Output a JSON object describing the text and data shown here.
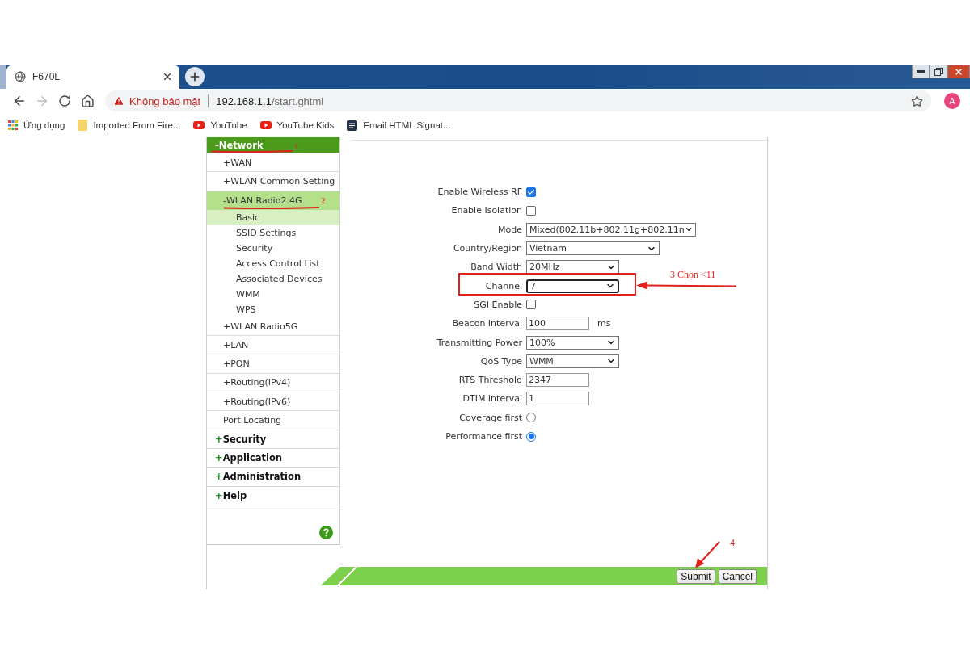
{
  "browser": {
    "tabs": [
      {
        "title": "F670L",
        "selected": true
      }
    ],
    "security": "Không bảo mật",
    "url_host": "192.168.1.1",
    "url_path": "/start.ghtml",
    "avatar": "A",
    "bookmarks": [
      {
        "kind": "apps",
        "label": "Ứng dụng"
      },
      {
        "kind": "folder",
        "label": "Imported From Fire..."
      },
      {
        "kind": "youtube",
        "label": "YouTube"
      },
      {
        "kind": "youtube",
        "label": "YouTube Kids"
      },
      {
        "kind": "page",
        "label": "Email HTML Signat..."
      }
    ]
  },
  "sidebar": [
    {
      "sign": "-",
      "label": "Network",
      "expanded": true,
      "annotation": "1",
      "children": [
        {
          "sign": "+",
          "label": "WAN",
          "expanded": false,
          "selected": false
        },
        {
          "sign": "+",
          "label": "WLAN Common Setting",
          "expanded": false,
          "selected": false
        },
        {
          "sign": "-",
          "label": "WLAN Radio2.4G",
          "expanded": true,
          "selected": true,
          "annotation": "2",
          "children": [
            {
              "label": "Basic",
              "selected": true
            },
            {
              "label": "SSID Settings",
              "selected": false
            },
            {
              "label": "Security",
              "selected": false
            },
            {
              "label": "Access Control List",
              "selected": false
            },
            {
              "label": "Associated Devices",
              "selected": false
            },
            {
              "label": "WMM",
              "selected": false
            },
            {
              "label": "WPS",
              "selected": false
            }
          ]
        },
        {
          "sign": "+",
          "label": "WLAN Radio5G",
          "expanded": false,
          "selected": false
        },
        {
          "sign": "+",
          "label": "LAN",
          "expanded": false,
          "selected": false
        },
        {
          "sign": "+",
          "label": "PON",
          "expanded": false,
          "selected": false
        },
        {
          "sign": "+",
          "label": "Routing(IPv4)",
          "expanded": false,
          "selected": false
        },
        {
          "sign": "+",
          "label": "Routing(IPv6)",
          "expanded": false,
          "selected": false
        },
        {
          "label": "Port Locating",
          "selected": false
        }
      ]
    },
    {
      "sign": "+",
      "label": "Security",
      "expanded": false
    },
    {
      "sign": "+",
      "label": "Application",
      "expanded": false
    },
    {
      "sign": "+",
      "label": "Administration",
      "expanded": false
    },
    {
      "sign": "+",
      "label": "Help",
      "expanded": false
    }
  ],
  "form": [
    {
      "kind": "checkbox",
      "label": "Enable Wireless RF",
      "checked": true
    },
    {
      "kind": "checkbox",
      "label": "Enable Isolation",
      "checked": false
    },
    {
      "kind": "select",
      "label": "Mode",
      "value": "Mixed(802.11b+802.11g+802.11n"
    },
    {
      "kind": "select",
      "label": "Country/Region",
      "value": "Vietnam"
    },
    {
      "kind": "select",
      "label": "Band Width",
      "value": "20MHz"
    },
    {
      "kind": "select",
      "label": "Channel",
      "value": "7",
      "focused": true,
      "annotation": "3 Chọn <11"
    },
    {
      "kind": "checkbox",
      "label": "SGI Enable",
      "checked": false
    },
    {
      "kind": "text",
      "label": "Beacon Interval",
      "value": "100",
      "unit": "ms"
    },
    {
      "kind": "select",
      "label": "Transmitting Power",
      "value": "100%"
    },
    {
      "kind": "select",
      "label": "QoS Type",
      "value": "WMM"
    },
    {
      "kind": "text",
      "label": "RTS Threshold",
      "value": "2347"
    },
    {
      "kind": "text",
      "label": "DTIM Interval",
      "value": "1"
    },
    {
      "kind": "radio",
      "label": "Coverage first",
      "selected": false
    },
    {
      "kind": "radio",
      "label": "Performance first",
      "selected": true
    }
  ],
  "footer": {
    "buttons": [
      {
        "label": "Submit",
        "annotation": "4"
      },
      {
        "label": "Cancel"
      }
    ]
  }
}
